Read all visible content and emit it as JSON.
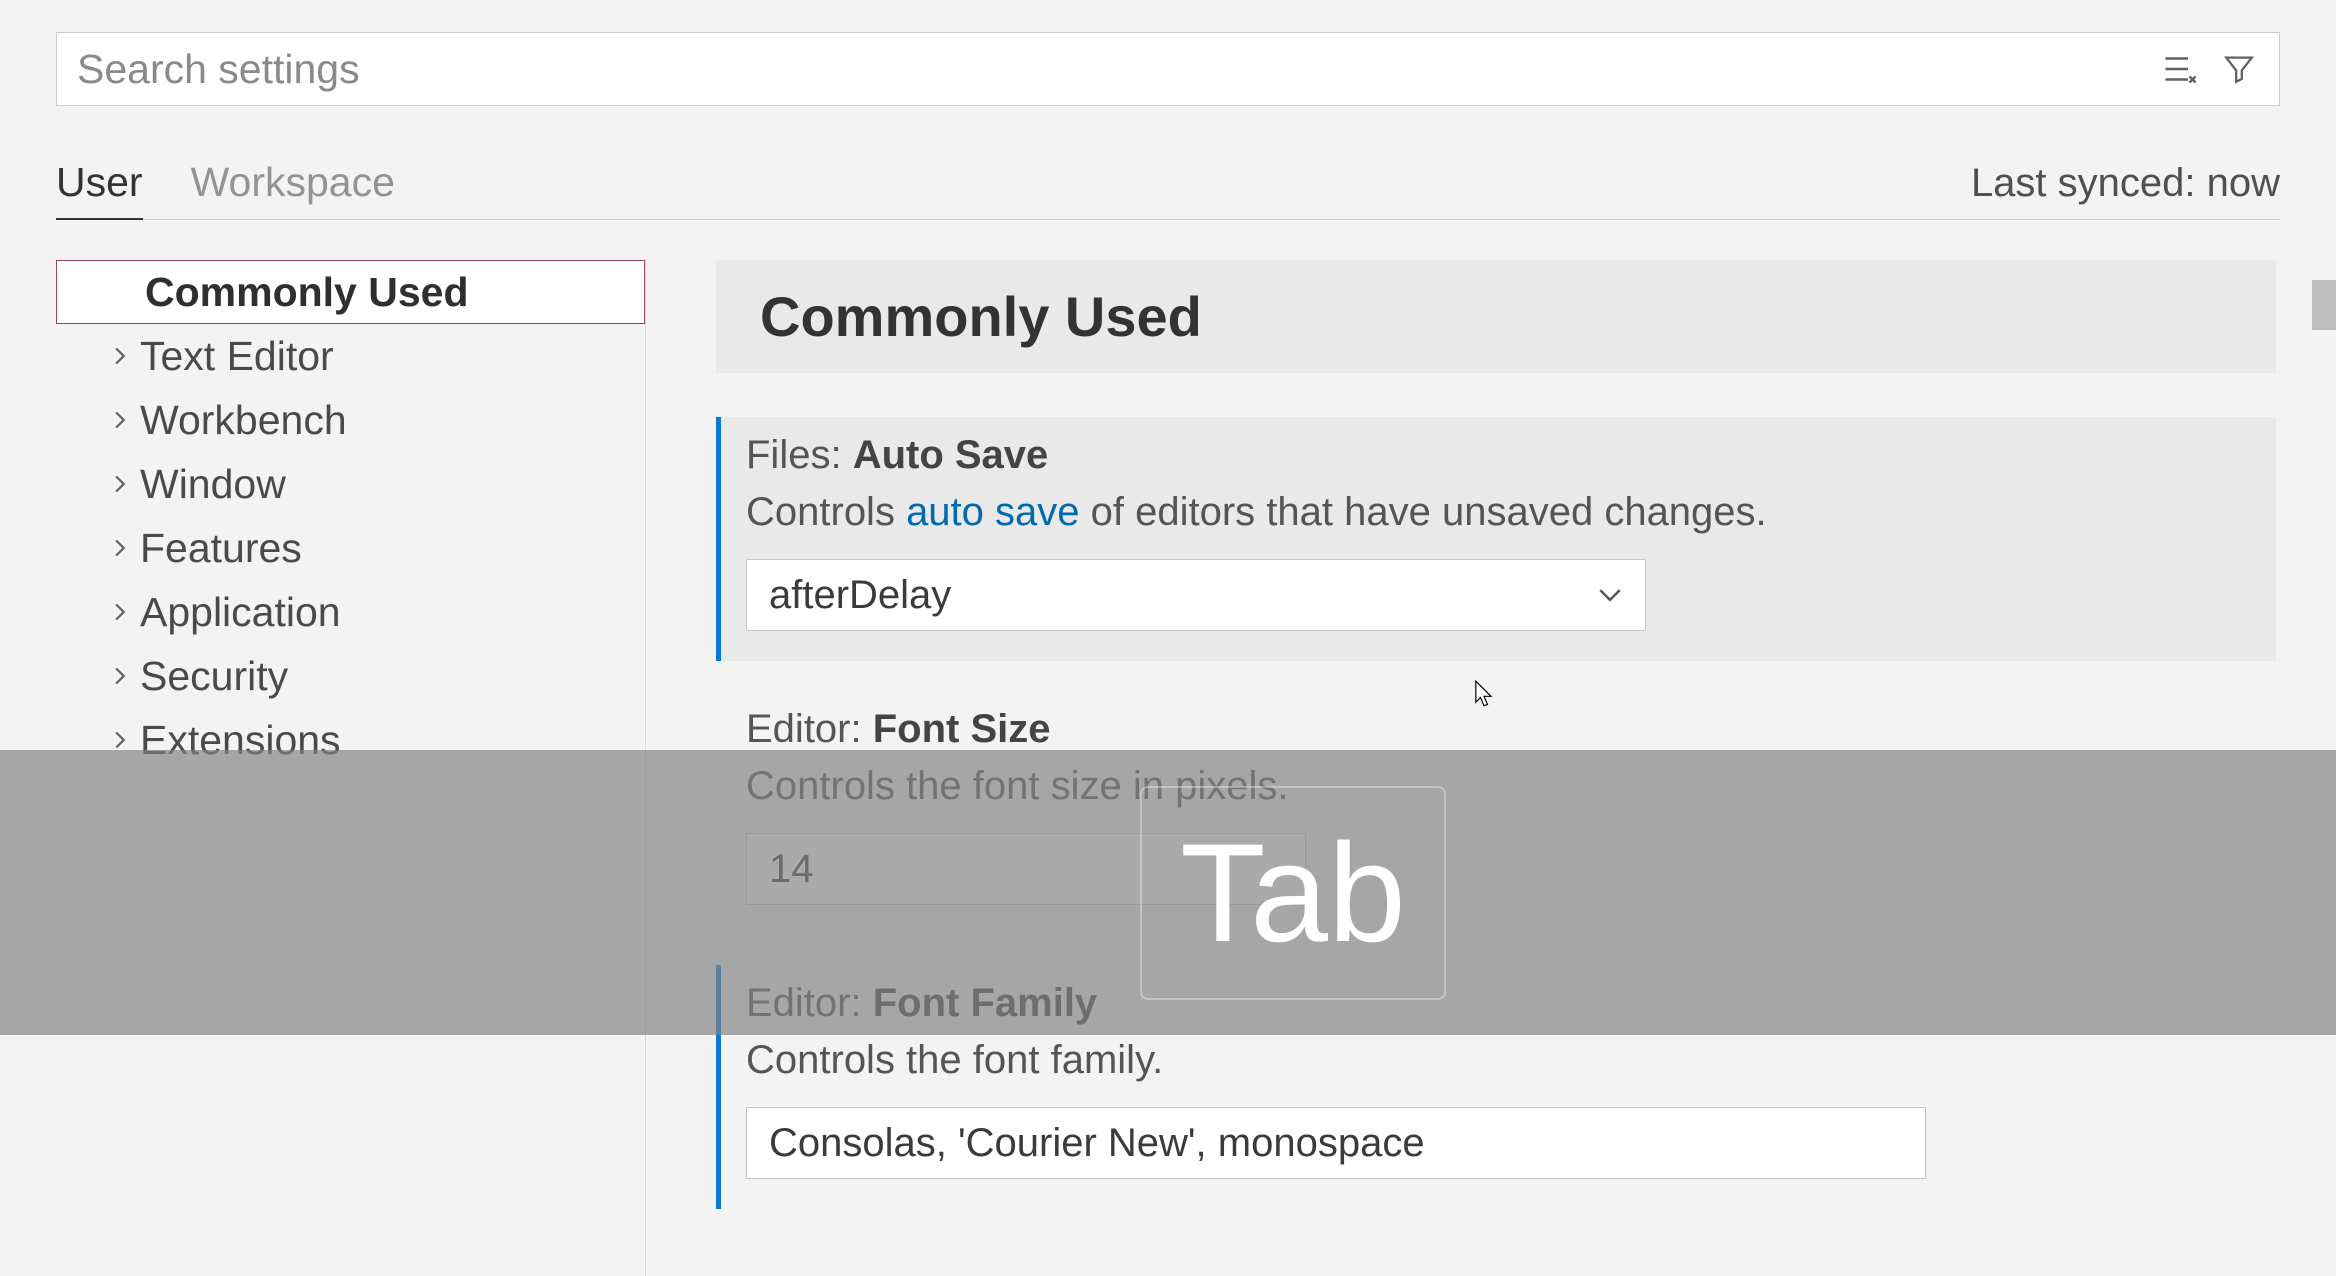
{
  "search": {
    "placeholder": "Search settings"
  },
  "tabs": {
    "user": "User",
    "workspace": "Workspace"
  },
  "sync_status": "Last synced: now",
  "outline": {
    "selected": "Commonly Used",
    "items": [
      "Text Editor",
      "Workbench",
      "Window",
      "Features",
      "Application",
      "Security",
      "Extensions"
    ]
  },
  "group_title": "Commonly Used",
  "settings": {
    "autosave": {
      "prefix": "Files: ",
      "name": "Auto Save",
      "desc_pre": "Controls ",
      "desc_link": "auto save",
      "desc_post": " of editors that have unsaved changes.",
      "value": "afterDelay"
    },
    "fontsize": {
      "prefix": "Editor: ",
      "name": "Font Size",
      "desc": "Controls the font size in pixels.",
      "value": "14"
    },
    "fontfamily": {
      "prefix": "Editor: ",
      "name": "Font Family",
      "desc": "Controls the font family.",
      "value": "Consolas, 'Courier New', monospace"
    }
  },
  "overlay_key": "Tab"
}
